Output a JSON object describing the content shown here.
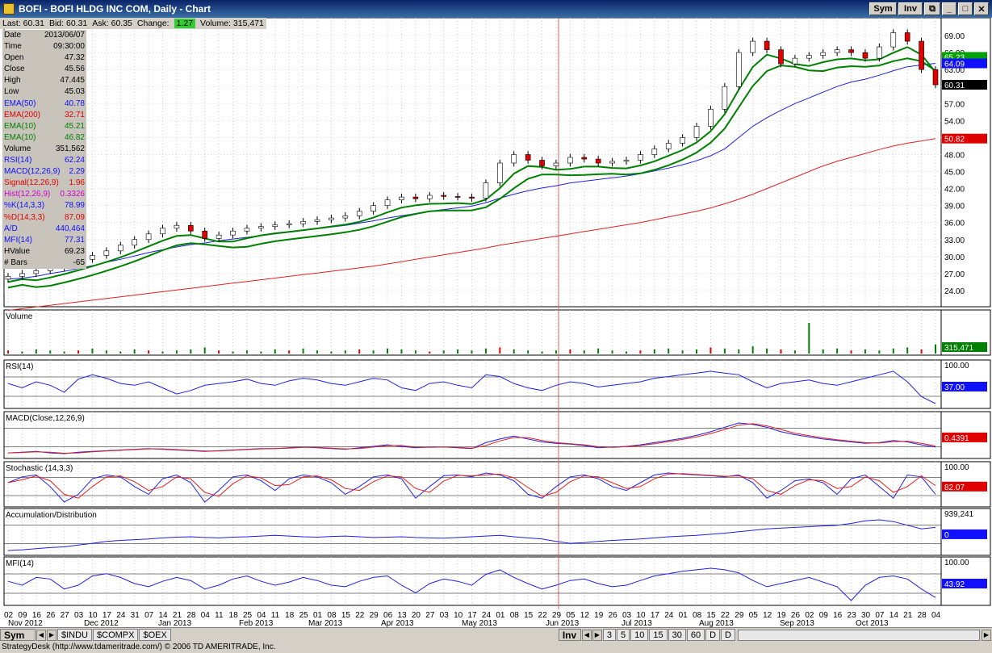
{
  "window": {
    "title": "BOFI - BOFI HLDG INC COM, Daily - Chart",
    "sym_label": "Sym",
    "inv_label": "Inv"
  },
  "quote": {
    "last": "Last: 60.31",
    "bid": "Bid: 60.31",
    "ask": "Ask: 60.35",
    "change_label": "Change:",
    "change": "1.27",
    "volume": "Volume: 315,471"
  },
  "data_panel": [
    {
      "label": "Date",
      "value": "2013/06/07",
      "color": "#000000"
    },
    {
      "label": "Time",
      "value": "09:30:00",
      "color": "#000000"
    },
    {
      "label": "Open",
      "value": "47.32",
      "color": "#000000"
    },
    {
      "label": "Close",
      "value": "45.56",
      "color": "#000000"
    },
    {
      "label": "High",
      "value": "47.445",
      "color": "#000000"
    },
    {
      "label": "Low",
      "value": "45.03",
      "color": "#000000"
    },
    {
      "label": "EMA(50)",
      "value": "40.78",
      "color": "#1010ff"
    },
    {
      "label": "EMA(200)",
      "value": "32.71",
      "color": "#e00000"
    },
    {
      "label": "EMA(10)",
      "value": "45.21",
      "color": "#008000"
    },
    {
      "label": "EMA(10)",
      "value": "46.82",
      "color": "#008000"
    },
    {
      "label": "Volume",
      "value": "351,562",
      "color": "#000000"
    },
    {
      "label": "RSI(14)",
      "value": "62.24",
      "color": "#1010ff"
    },
    {
      "label": "MACD(12,26,9)",
      "value": "2.29",
      "color": "#1010ff"
    },
    {
      "label": "Signal(12,26,9)",
      "value": "1.96",
      "color": "#e00000"
    },
    {
      "label": "Hist(12,26,9)",
      "value": "0.3326",
      "color": "#d000d0"
    },
    {
      "label": "%K(14,3,3)",
      "value": "78.99",
      "color": "#1010ff"
    },
    {
      "label": "%D(14,3,3)",
      "value": "87.09",
      "color": "#e00000"
    },
    {
      "label": "A/D",
      "value": "440,464",
      "color": "#1010ff"
    },
    {
      "label": "MFI(14)",
      "value": "77.31",
      "color": "#1010ff"
    },
    {
      "label": "HValue",
      "value": "69.23",
      "color": "#000000"
    },
    {
      "label": "# Bars",
      "value": "-65",
      "color": "#000000"
    }
  ],
  "chart_data": [
    {
      "type": "candlestick",
      "title": "",
      "y_ticks": [
        "69.00",
        "66.00",
        "63.00",
        "60.00",
        "57.00",
        "54.00",
        "51.00",
        "48.00",
        "45.00",
        "42.00",
        "39.00",
        "36.00",
        "33.00",
        "30.00",
        "27.00",
        "24.00"
      ],
      "ylim": [
        22,
        71
      ],
      "closes": [
        26.5,
        27,
        27.5,
        28,
        28.8,
        29.5,
        30.2,
        31,
        32,
        33,
        34,
        35,
        35.5,
        34.5,
        33.2,
        33.8,
        34.5,
        35,
        35.3,
        35.6,
        35.8,
        36.2,
        36.5,
        36.8,
        37.2,
        38,
        39,
        40,
        40.5,
        40.2,
        40.8,
        40.6,
        40.5,
        40.3,
        43,
        46.5,
        48,
        47,
        46,
        46.5,
        47.5,
        47.2,
        46.5,
        46.8,
        47,
        48,
        49,
        50,
        51,
        53,
        56,
        60,
        66,
        68,
        66.5,
        64,
        65,
        65.5,
        66,
        66.5,
        66,
        65,
        67,
        69.5,
        68,
        63,
        60.31
      ],
      "ema50": [
        26,
        26.2,
        26.5,
        27,
        27.4,
        27.9,
        28.4,
        29,
        29.5,
        30.1,
        30.7,
        31.2,
        31.7,
        32.1,
        32.4,
        32.8,
        33.1,
        33.4,
        33.7,
        34,
        34.3,
        34.6,
        34.9,
        35.2,
        35.5,
        35.9,
        36.3,
        36.8,
        37.2,
        37.6,
        38,
        38.3,
        38.6,
        38.9,
        39.5,
        40.3,
        41,
        41.6,
        42.1,
        42.5,
        43,
        43.3,
        43.6,
        43.9,
        44.2,
        44.6,
        45.1,
        45.6,
        46.2,
        46.9,
        47.8,
        49,
        51,
        53,
        54.5,
        55.8,
        57,
        58,
        59,
        60,
        60.8,
        61.3,
        62,
        62.8,
        63.5,
        63.8,
        64.09
      ],
      "ema200": [
        20.5,
        20.8,
        21.1,
        21.4,
        21.7,
        22,
        22.3,
        22.6,
        22.9,
        23.2,
        23.5,
        23.8,
        24.1,
        24.4,
        24.7,
        25,
        25.3,
        25.6,
        25.9,
        26.2,
        26.5,
        26.8,
        27.1,
        27.4,
        27.7,
        28,
        28.3,
        28.7,
        29.1,
        29.5,
        29.9,
        30.3,
        30.7,
        31.1,
        31.5,
        32,
        32.4,
        32.8,
        33.2,
        33.6,
        34,
        34.4,
        34.8,
        35.2,
        35.6,
        36,
        36.5,
        37,
        37.5,
        38,
        38.6,
        39.3,
        40.1,
        41,
        42,
        43,
        44,
        45,
        46,
        46.8,
        47.5,
        48.2,
        48.9,
        49.5,
        50,
        50.4,
        50.82
      ],
      "price_labels": [
        {
          "text": "65.23",
          "color": "#00a000"
        },
        {
          "text": "64.09",
          "color": "#1010ff"
        },
        {
          "text": "60.31",
          "color": "#000000"
        },
        {
          "text": "50.82",
          "color": "#e00000"
        }
      ]
    },
    {
      "type": "bar",
      "title": "Volume",
      "label": "315,471",
      "values": [
        3,
        2,
        4,
        3,
        2,
        3,
        5,
        3,
        2,
        4,
        3,
        2,
        3,
        4,
        6,
        3,
        2,
        3,
        2,
        4,
        3,
        5,
        3,
        2,
        3,
        4,
        3,
        5,
        4,
        3,
        2,
        3,
        4,
        3,
        5,
        6,
        4,
        3,
        2,
        3,
        4,
        3,
        5,
        3,
        2,
        3,
        4,
        5,
        3,
        4,
        6,
        5,
        4,
        7,
        5,
        4,
        3,
        30,
        4,
        5,
        3,
        4,
        3,
        5,
        6,
        4,
        9
      ]
    },
    {
      "type": "line",
      "title": "RSI(14)",
      "y_ticks": [
        "100.00",
        "37.00"
      ],
      "values": [
        60,
        55,
        62,
        58,
        50,
        65,
        70,
        66,
        60,
        58,
        62,
        55,
        48,
        52,
        58,
        60,
        62,
        65,
        60,
        58,
        63,
        66,
        64,
        60,
        58,
        62,
        66,
        64,
        55,
        52,
        60,
        62,
        58,
        55,
        70,
        68,
        60,
        55,
        52,
        58,
        62,
        60,
        56,
        58,
        60,
        62,
        66,
        68,
        70,
        72,
        74,
        72,
        70,
        62,
        55,
        60,
        62,
        64,
        60,
        58,
        62,
        66,
        70,
        74,
        62,
        45,
        37
      ]
    },
    {
      "type": "line",
      "title": "MACD(Close,12,26,9)",
      "y_ticks": [
        "0.4391"
      ],
      "values": [
        0.1,
        0.2,
        0.3,
        0.1,
        0,
        0.2,
        0.3,
        0.4,
        0.5,
        0.6,
        0.7,
        0.6,
        0.5,
        0.4,
        0.3,
        0.4,
        0.5,
        0.6,
        0.7,
        0.7,
        0.8,
        0.9,
        0.8,
        0.7,
        0.6,
        0.8,
        1,
        1.2,
        1,
        0.8,
        0.9,
        0.9,
        0.8,
        0.7,
        1.5,
        2,
        2.4,
        2,
        1.6,
        1.4,
        1.3,
        1.1,
        0.8,
        0.9,
        1,
        1.2,
        1.5,
        1.8,
        2.1,
        2.5,
        3,
        3.6,
        4.2,
        4,
        3.6,
        3,
        2.6,
        2.3,
        2,
        1.8,
        1.6,
        1.4,
        1.5,
        1.8,
        1.6,
        1.2,
        0.9
      ]
    },
    {
      "type": "line",
      "title": "Stochastic (14,3,3)",
      "y_ticks": [
        "100.00",
        "82.07"
      ],
      "values": [
        70,
        85,
        90,
        60,
        20,
        40,
        80,
        90,
        85,
        60,
        40,
        80,
        90,
        70,
        20,
        50,
        85,
        90,
        75,
        50,
        80,
        90,
        85,
        70,
        40,
        60,
        85,
        90,
        80,
        30,
        60,
        88,
        90,
        85,
        95,
        90,
        75,
        40,
        30,
        60,
        85,
        90,
        80,
        60,
        50,
        70,
        90,
        95,
        92,
        90,
        88,
        85,
        90,
        70,
        30,
        50,
        75,
        80,
        70,
        40,
        80,
        90,
        60,
        30,
        90,
        85,
        40
      ]
    },
    {
      "type": "line",
      "title": "Accumulation/Distribution",
      "y_ticks": [
        "939,241",
        "0"
      ],
      "values": [
        10,
        12,
        15,
        18,
        20,
        25,
        30,
        35,
        38,
        40,
        42,
        45,
        47,
        48,
        46,
        45,
        47,
        48,
        50,
        52,
        50,
        48,
        47,
        49,
        50,
        48,
        46,
        47,
        48,
        46,
        45,
        44,
        46,
        48,
        50,
        52,
        48,
        45,
        42,
        35,
        30,
        32,
        35,
        38,
        40,
        42,
        45,
        48,
        50,
        52,
        55,
        58,
        62,
        66,
        70,
        72,
        74,
        76,
        78,
        80,
        85,
        92,
        95,
        90,
        80,
        70,
        74
      ]
    },
    {
      "type": "line",
      "title": "MFI(14)",
      "y_ticks": [
        "100.00",
        "43.92"
      ],
      "values": [
        65,
        60,
        70,
        68,
        55,
        60,
        72,
        75,
        70,
        62,
        58,
        65,
        70,
        66,
        55,
        60,
        68,
        72,
        65,
        60,
        64,
        70,
        66,
        60,
        58,
        65,
        70,
        72,
        60,
        50,
        62,
        68,
        65,
        60,
        74,
        80,
        70,
        62,
        55,
        60,
        66,
        68,
        62,
        58,
        60,
        66,
        72,
        75,
        78,
        80,
        82,
        80,
        76,
        66,
        58,
        62,
        66,
        70,
        64,
        58,
        40,
        60,
        70,
        72,
        68,
        55,
        43.92
      ]
    }
  ],
  "x_axis": {
    "days": [
      "02",
      "09",
      "16",
      "26",
      "27",
      "03",
      "10",
      "17",
      "24",
      "31",
      "07",
      "14",
      "21",
      "28",
      "04",
      "11",
      "18",
      "25",
      "04",
      "11",
      "18",
      "25",
      "01",
      "08",
      "15",
      "22",
      "29",
      "06",
      "13",
      "20",
      "27",
      "03",
      "10",
      "17",
      "24",
      "01",
      "08",
      "15",
      "22",
      "29",
      "05",
      "12",
      "19",
      "26",
      "03",
      "10",
      "17",
      "24",
      "01",
      "08",
      "15",
      "22",
      "29",
      "05",
      "12",
      "19",
      "26",
      "02",
      "09",
      "16",
      "23",
      "30",
      "07",
      "14",
      "21",
      "28",
      "04"
    ],
    "months": [
      "Nov 2012",
      "Dec 2012",
      "Jan 2013",
      "Feb 2013",
      "Mar 2013",
      "Apr 2013",
      "May 2013",
      "Jun 2013",
      "Jul 2013",
      "Aug 2013",
      "Sep 2013",
      "Oct 2013"
    ]
  },
  "tabs": {
    "items": [
      "$INDU",
      "$COMPX",
      "$OEX"
    ],
    "inv_label": "Inv",
    "intervals": [
      "3",
      "5",
      "10",
      "15",
      "30",
      "60",
      "D",
      "D"
    ]
  },
  "status": "StrategyDesk (http://www.tdameritrade.com/) © 2006 TD AMERITRADE, Inc."
}
